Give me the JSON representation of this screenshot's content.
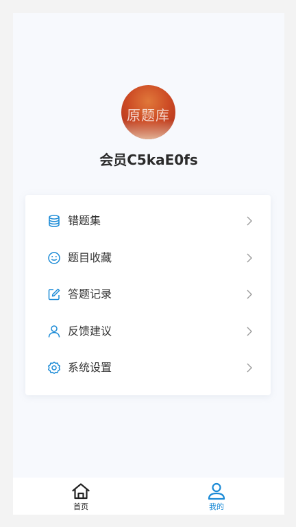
{
  "profile": {
    "avatar_text": "原题库",
    "username": "会员C5kaE0fs"
  },
  "menu": {
    "items": [
      {
        "label": "错题集",
        "icon": "database-icon"
      },
      {
        "label": "题目收藏",
        "icon": "smile-icon"
      },
      {
        "label": "答题记录",
        "icon": "edit-icon"
      },
      {
        "label": "反馈建议",
        "icon": "user-icon"
      },
      {
        "label": "系统设置",
        "icon": "gear-icon"
      }
    ]
  },
  "tabbar": {
    "tabs": [
      {
        "label": "首页",
        "icon": "home-icon",
        "active": false
      },
      {
        "label": "我的",
        "icon": "user-icon",
        "active": true
      }
    ]
  },
  "colors": {
    "accent": "#1a8ad6",
    "text": "#333333",
    "inactive_tab": "#222222"
  }
}
